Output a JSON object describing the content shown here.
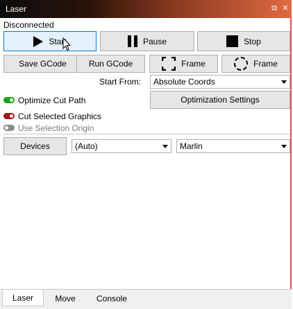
{
  "window": {
    "title": "Laser",
    "status": "Disconnected"
  },
  "controls": {
    "start_label": "Start",
    "pause_label": "Pause",
    "stop_label": "Stop",
    "save_gcode_label": "Save GCode",
    "run_gcode_label": "Run GCode",
    "frame_rect_label": "Frame",
    "frame_circle_label": "Frame"
  },
  "start_from": {
    "label": "Start From:",
    "value": "Absolute Coords"
  },
  "optimization_settings_label": "Optimization Settings",
  "options": [
    {
      "label": "Optimize Cut Path",
      "state": "on",
      "color": "#1aa31a"
    },
    {
      "label": "Cut Selected Graphics",
      "state": "on",
      "color": "#a01818"
    },
    {
      "label": "Use Selection Origin",
      "state": "off",
      "color": "#8a8a8a"
    }
  ],
  "devices": {
    "button_label": "Devices",
    "port_value": "(Auto)",
    "firmware_value": "Marlin"
  },
  "tabs": [
    "Laser",
    "Move",
    "Console"
  ],
  "active_tab": "Laser"
}
